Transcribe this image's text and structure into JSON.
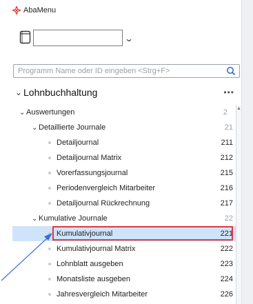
{
  "app": {
    "title": "AbaMenu"
  },
  "toolbar": {
    "book_icon": "book-icon",
    "combo_value": "",
    "combo_icon": "chevron-down-icon"
  },
  "search": {
    "placeholder": "Programm Name oder ID eingeben <Strg+F>",
    "icon": "search-icon"
  },
  "tree": {
    "root": {
      "label": "Lohnbuchhaltung",
      "more": "•••"
    },
    "items": [
      {
        "label": "Auswertungen",
        "num": "2",
        "level": 1,
        "type": "group"
      },
      {
        "label": "Detaillierte Journale",
        "num": "21",
        "level": 2,
        "type": "group"
      },
      {
        "label": "Detailjournal",
        "num": "211",
        "level": 3,
        "type": "leaf"
      },
      {
        "label": "Detailjournal Matrix",
        "num": "212",
        "level": 3,
        "type": "leaf"
      },
      {
        "label": "Vorerfassungsjournal",
        "num": "215",
        "level": 3,
        "type": "leaf"
      },
      {
        "label": "Periodenvergleich Mitarbeiter",
        "num": "216",
        "level": 3,
        "type": "leaf"
      },
      {
        "label": "Detailjournal Rückrechnung",
        "num": "217",
        "level": 3,
        "type": "leaf"
      },
      {
        "label": "Kumulative Journale",
        "num": "22",
        "level": 2,
        "type": "group"
      },
      {
        "label": "Kumulativjournal",
        "num": "221",
        "level": 3,
        "type": "leaf",
        "selected": true
      },
      {
        "label": "Kumulativjournal Matrix",
        "num": "222",
        "level": 3,
        "type": "leaf"
      },
      {
        "label": "Lohnblatt ausgeben",
        "num": "223",
        "level": 3,
        "type": "leaf"
      },
      {
        "label": "Monatsliste ausgeben",
        "num": "224",
        "level": 3,
        "type": "leaf"
      },
      {
        "label": "Jahresvergleich Mitarbeiter",
        "num": "226",
        "level": 3,
        "type": "leaf"
      }
    ]
  },
  "colors": {
    "selection_bg": "#cfe3fb",
    "highlight_border": "#e0393e",
    "arrow": "#3b6fd8",
    "muted_number": "#9aa0a6"
  }
}
